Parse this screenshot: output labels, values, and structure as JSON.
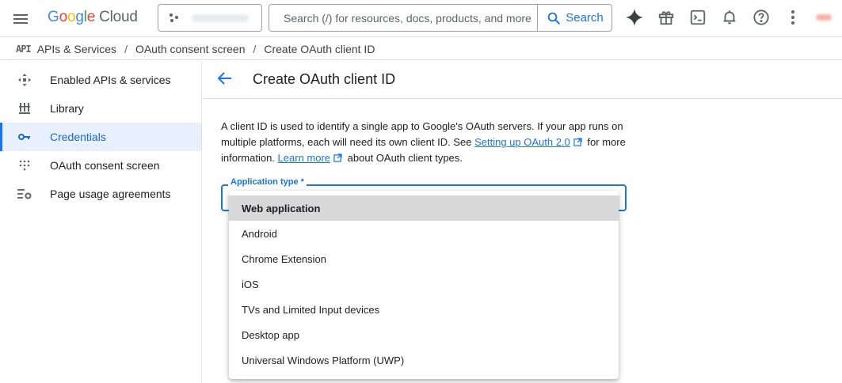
{
  "header": {
    "logo": {
      "g": "G",
      "o1": "o",
      "o2": "o",
      "g2": "g",
      "l": "l",
      "e": "e",
      "cloud": "Cloud"
    },
    "search": {
      "placeholder": "Search (/) for resources, docs, products, and more",
      "button_label": "Search"
    },
    "icons": [
      "menu-icon",
      "gemini-sparkle-icon",
      "gift-icon",
      "cloud-shell-icon",
      "notifications-bell-icon",
      "help-icon",
      "more-vert-icon"
    ]
  },
  "breadcrumb": {
    "mark": "API",
    "items": [
      "APIs & Services",
      "OAuth consent screen",
      "Create OAuth client ID"
    ],
    "separator": "/"
  },
  "sidebar": {
    "items": [
      {
        "label": "Enabled APIs & services",
        "icon": "api-services-icon"
      },
      {
        "label": "Library",
        "icon": "library-icon"
      },
      {
        "label": "Credentials",
        "icon": "key-icon",
        "active": true
      },
      {
        "label": "OAuth consent screen",
        "icon": "oauth-dots-icon"
      },
      {
        "label": "Page usage agreements",
        "icon": "settings-list-icon"
      }
    ]
  },
  "main": {
    "title": "Create OAuth client ID",
    "desc": {
      "part1": "A client ID is used to identify a single app to Google's OAuth servers. If your app runs on multiple platforms, each will need its own client ID. See ",
      "link1": "Setting up OAuth 2.0",
      "part2": " for more information. ",
      "link2": "Learn more",
      "part3": " about OAuth client types."
    },
    "application_type": {
      "label": "Application type *",
      "options": [
        "Web application",
        "Android",
        "Chrome Extension",
        "iOS",
        "TVs and Limited Input devices",
        "Desktop app",
        "Universal Windows Platform (UWP)"
      ],
      "highlighted": "Web application"
    }
  },
  "colors": {
    "accent": "#1a73e8",
    "active_bg": "#e8f0fe",
    "highlight": "#d8d8d8"
  }
}
